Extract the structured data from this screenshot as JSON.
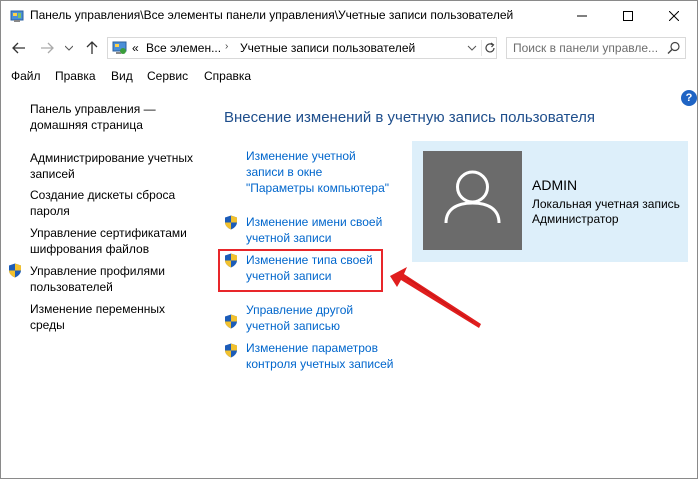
{
  "window": {
    "title": "Панель управления\\Все элементы панели управления\\Учетные записи пользователей"
  },
  "address": {
    "chevrons": "«",
    "crumb1": "Все элемен...",
    "separator": "›",
    "crumb2": "Учетные записи пользователей"
  },
  "search": {
    "placeholder": "Поиск в панели управле..."
  },
  "menu": {
    "items": [
      "Файл",
      "Правка",
      "Вид",
      "Сервис",
      "Справка"
    ]
  },
  "sidebar": {
    "items": [
      {
        "label_line1": "Панель управления —",
        "label_line2": "домашняя страница",
        "shield": false
      },
      {
        "label_line1": "Администрирование учетных",
        "label_line2": "записей",
        "shield": false
      },
      {
        "label_line1": "Создание дискеты сброса",
        "label_line2": "пароля",
        "shield": false
      },
      {
        "label_line1": "Управление сертификатами",
        "label_line2": "шифрования файлов",
        "shield": false
      },
      {
        "label_line1": "Управление профилями",
        "label_line2": "пользователей",
        "shield": true
      },
      {
        "label_line1": "Изменение переменных",
        "label_line2": "среды",
        "shield": false
      }
    ]
  },
  "main": {
    "heading": "Внесение изменений в учетную запись пользователя",
    "tasks": [
      {
        "line1": "Изменение учетной",
        "line2": "записи в окне",
        "line3": "\"Параметры компьютера\"",
        "shield": false
      },
      {
        "line1": "Изменение имени своей",
        "line2": "учетной записи",
        "shield": true
      },
      {
        "line1": "Изменение типа своей",
        "line2": "учетной записи",
        "shield": true,
        "highlighted": true
      },
      {
        "line1": "Управление другой",
        "line2": "учетной записью",
        "shield": true
      },
      {
        "line1": "Изменение параметров",
        "line2": "контроля учетных записей",
        "shield": true
      }
    ]
  },
  "user": {
    "name": "ADMIN",
    "type_line1": "Локальная учетная запись",
    "type_line2": "Администратор"
  },
  "help_label": "?",
  "colors": {
    "link": "#0066cc",
    "heading": "#1e4e8c",
    "user_panel_bg": "#ddeffa",
    "avatar_bg": "#6b6b6b",
    "highlight": "#e8262a",
    "annotation_arrow": "#e01e1e"
  },
  "icons": {
    "app": "control-panel-icon",
    "shield": "uac-shield-icon",
    "avatar": "user-silhouette-icon",
    "help": "help-icon"
  }
}
